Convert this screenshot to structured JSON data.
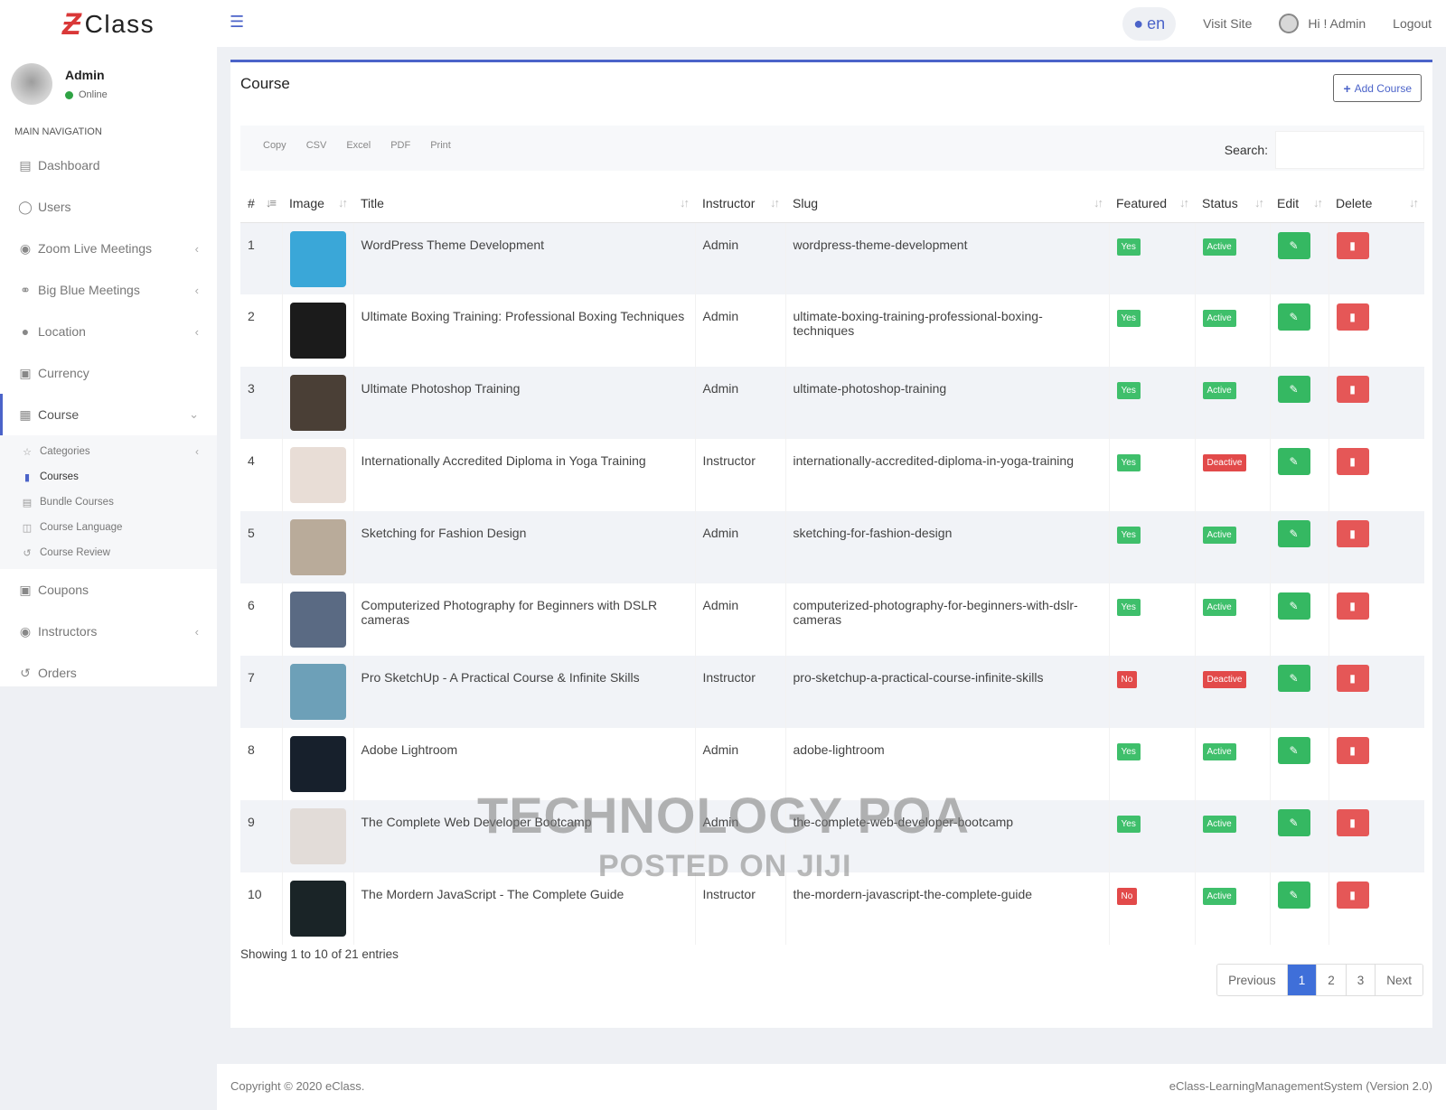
{
  "app": {
    "logo_mark": "Ƶ",
    "logo_text": "Class"
  },
  "user": {
    "name": "Admin",
    "status": "Online"
  },
  "sidebar": {
    "header": "MAIN NAVIGATION",
    "items": [
      {
        "label": "Dashboard",
        "icon": "dashboard-icon"
      },
      {
        "label": "Users",
        "icon": "user-icon"
      },
      {
        "label": "Zoom Live Meetings",
        "icon": "video-icon"
      },
      {
        "label": "Big Blue Meetings",
        "icon": "handshake-icon"
      },
      {
        "label": "Location",
        "icon": "globe-icon"
      },
      {
        "label": "Currency",
        "icon": "money-icon"
      },
      {
        "label": "Course",
        "icon": "calendar-icon"
      },
      {
        "label": "Coupons",
        "icon": "cc-icon"
      },
      {
        "label": "Instructors",
        "icon": "user-circle-icon"
      },
      {
        "label": "Orders",
        "icon": "history-icon"
      }
    ],
    "course_sub": [
      {
        "label": "Categories",
        "icon": "star-icon"
      },
      {
        "label": "Courses",
        "icon": "book-icon"
      },
      {
        "label": "Bundle Courses",
        "icon": "bundle-icon"
      },
      {
        "label": "Course Language",
        "icon": "language-icon"
      },
      {
        "label": "Course Review",
        "icon": "history-icon"
      }
    ]
  },
  "topbar": {
    "lang": "en",
    "visit_site": "Visit Site",
    "greeting": "Hi ! Admin",
    "logout": "Logout"
  },
  "card": {
    "title": "Course",
    "add_button": "Add Course",
    "export": [
      "Copy",
      "CSV",
      "Excel",
      "PDF",
      "Print"
    ],
    "search_label": "Search:"
  },
  "table": {
    "headers": [
      "#",
      "Image",
      "Title",
      "Instructor",
      "Slug",
      "Featured",
      "Status",
      "Edit",
      "Delete"
    ],
    "rows": [
      {
        "num": "1",
        "title": "WordPress Theme Development",
        "instructor": "Admin",
        "slug": "wordpress-theme-development",
        "featured": "Yes",
        "status": "Active",
        "thumb": "#3aa7d8"
      },
      {
        "num": "2",
        "title": "Ultimate Boxing Training: Professional Boxing Techniques",
        "instructor": "Admin",
        "slug": "ultimate-boxing-training-professional-boxing-techniques",
        "featured": "Yes",
        "status": "Active",
        "thumb": "#1b1b1b"
      },
      {
        "num": "3",
        "title": "Ultimate Photoshop Training",
        "instructor": "Admin",
        "slug": "ultimate-photoshop-training",
        "featured": "Yes",
        "status": "Active",
        "thumb": "#4a3f36"
      },
      {
        "num": "4",
        "title": "Internationally Accredited Diploma in Yoga Training",
        "instructor": "Instructor",
        "slug": "internationally-accredited-diploma-in-yoga-training",
        "featured": "Yes",
        "status": "Deactive",
        "thumb": "#e8ddd6"
      },
      {
        "num": "5",
        "title": "Sketching for Fashion Design",
        "instructor": "Admin",
        "slug": "sketching-for-fashion-design",
        "featured": "Yes",
        "status": "Active",
        "thumb": "#b9ab9a"
      },
      {
        "num": "6",
        "title": "Computerized Photography for Beginners with DSLR cameras",
        "instructor": "Admin",
        "slug": "computerized-photography-for-beginners-with-dslr-cameras",
        "featured": "Yes",
        "status": "Active",
        "thumb": "#5a6a83"
      },
      {
        "num": "7",
        "title": "Pro SketchUp - A Practical Course & Infinite Skills",
        "instructor": "Instructor",
        "slug": "pro-sketchup-a-practical-course-infinite-skills",
        "featured": "No",
        "status": "Deactive",
        "thumb": "#6da0b8"
      },
      {
        "num": "8",
        "title": "Adobe Lightroom",
        "instructor": "Admin",
        "slug": "adobe-lightroom",
        "featured": "Yes",
        "status": "Active",
        "thumb": "#17202c"
      },
      {
        "num": "9",
        "title": "The Complete Web Developer Bootcamp",
        "instructor": "Admin",
        "slug": "the-complete-web-developer-bootcamp",
        "featured": "Yes",
        "status": "Active",
        "thumb": "#e2dcd8"
      },
      {
        "num": "10",
        "title": "The Mordern JavaScript - The Complete Guide",
        "instructor": "Instructor",
        "slug": "the-mordern-javascript-the-complete-guide",
        "featured": "No",
        "status": "Active",
        "thumb": "#1a2427"
      }
    ]
  },
  "pagination": {
    "info": "Showing 1 to 10 of 21 entries",
    "previous": "Previous",
    "pages": [
      "1",
      "2",
      "3"
    ],
    "next": "Next"
  },
  "footer": {
    "copyright": "Copyright © 2020 eClass.",
    "version": "eClass-LearningManagementSystem (Version 2.0)"
  },
  "watermark": {
    "line1": "TECHNOLOGY POA",
    "line2": "POSTED ON JIJI"
  },
  "colors": {
    "accent": "#4b63c9",
    "success": "#3fbf6b",
    "danger": "#e24a4a",
    "logo": "#d93838"
  }
}
